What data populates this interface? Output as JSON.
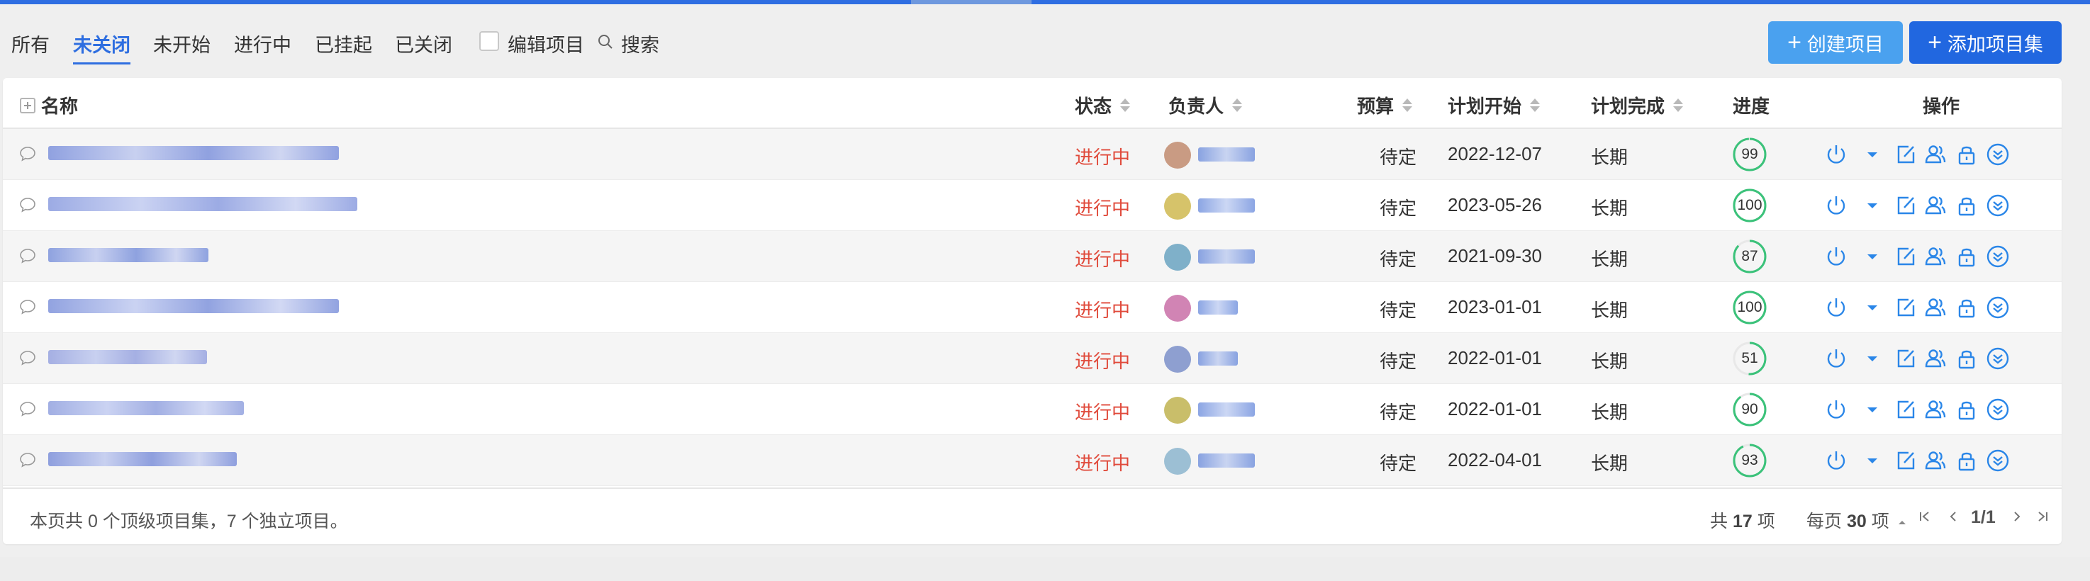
{
  "filters": {
    "tabs": [
      {
        "label": "所有"
      },
      {
        "label": "未关闭"
      },
      {
        "label": "未开始"
      },
      {
        "label": "进行中"
      },
      {
        "label": "已挂起"
      },
      {
        "label": "已关闭"
      }
    ],
    "active_tab": "未关闭",
    "edit_checkbox_label": "编辑项目",
    "search_label": "搜索"
  },
  "actions": {
    "create_project": "创建项目",
    "add_project_set": "添加项目集"
  },
  "table": {
    "columns": {
      "name": "名称",
      "status": "状态",
      "owner": "负责人",
      "budget": "预算",
      "plan_start": "计划开始",
      "plan_end": "计划完成",
      "progress": "进度",
      "actions": "操作"
    },
    "rows": [
      {
        "status": "进行中",
        "budget": "待定",
        "plan_start": "2022-12-07",
        "plan_end": "长期",
        "progress": 99
      },
      {
        "status": "进行中",
        "budget": "待定",
        "plan_start": "2023-05-26",
        "plan_end": "长期",
        "progress": 100
      },
      {
        "status": "进行中",
        "budget": "待定",
        "plan_start": "2021-09-30",
        "plan_end": "长期",
        "progress": 87
      },
      {
        "status": "进行中",
        "budget": "待定",
        "plan_start": "2023-01-01",
        "plan_end": "长期",
        "progress": 100
      },
      {
        "status": "进行中",
        "budget": "待定",
        "plan_start": "2022-01-01",
        "plan_end": "长期",
        "progress": 51
      },
      {
        "status": "进行中",
        "budget": "待定",
        "plan_start": "2022-01-01",
        "plan_end": "长期",
        "progress": 90
      },
      {
        "status": "进行中",
        "budget": "待定",
        "plan_start": "2022-04-01",
        "plan_end": "长期",
        "progress": 93
      }
    ]
  },
  "footer": {
    "summary": "本页共 0 个顶级项目集，7 个独立项目。",
    "total_prefix": "共",
    "total_count": "17",
    "total_suffix": "项",
    "per_page_prefix": "每页",
    "per_page_count": "30",
    "per_page_suffix": "项",
    "page_indicator": "1/1"
  },
  "colors": {
    "accent": "#2e6ee0",
    "status_in_progress": "#e04a3b",
    "progress_ring": "#3bc27a",
    "icon_blue": "#2a86e8"
  },
  "icons": {
    "row": "chat-bubble-icon",
    "ops": [
      "power-icon",
      "dropdown-caret-icon",
      "edit-icon",
      "members-icon",
      "lock-icon",
      "more-circle-icon"
    ]
  }
}
